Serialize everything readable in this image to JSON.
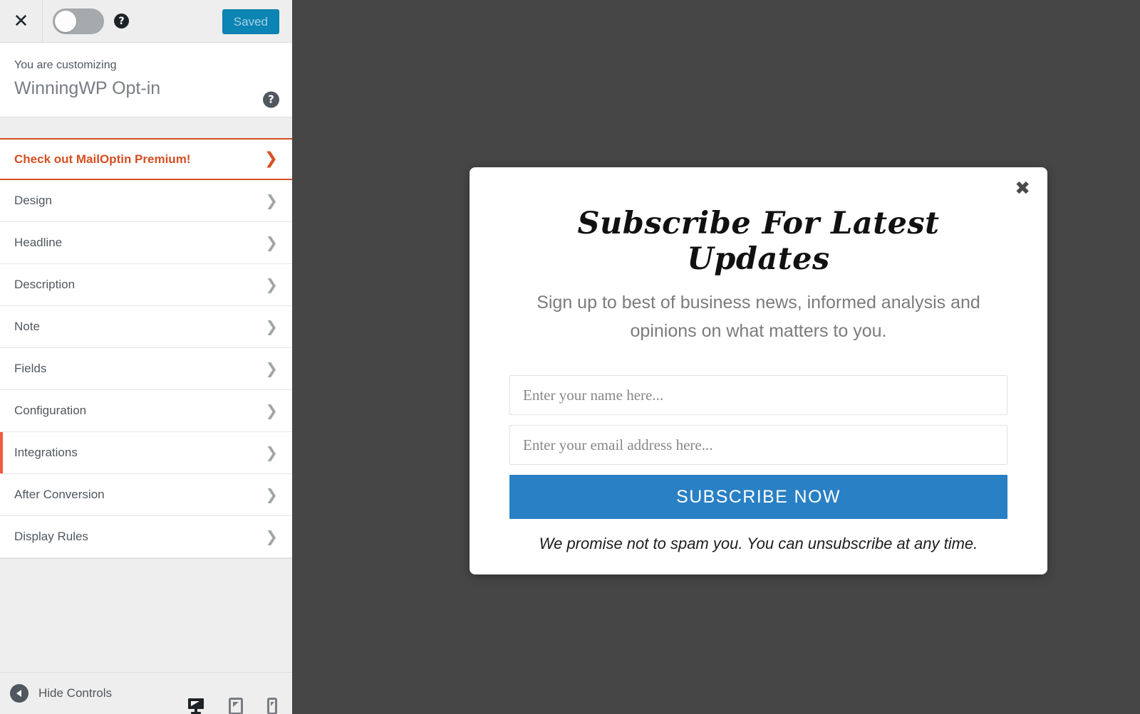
{
  "colors": {
    "accent_orange": "#d54e21",
    "active_marker": "#f15a41",
    "save_button_blue": "#0c84b4",
    "subscribe_blue": "#2980c4",
    "preview_overlay": "#464646",
    "sidebar_bg": "#eeeeee",
    "text_gray": "#50575e"
  },
  "topbar": {
    "close_icon": "close-icon",
    "close_glyph": "✕",
    "toggle": {
      "name": "preview-toggle",
      "state": "off"
    },
    "help_icon_glyph": "?",
    "save_button_label": "Saved"
  },
  "panel_header": {
    "eyebrow": "You are customizing",
    "title": "WinningWP Opt-in",
    "help_icon_glyph": "?"
  },
  "menu": {
    "chevron_glyph": "❯",
    "items": [
      {
        "label": "Check out MailOptin Premium!",
        "style": "premium",
        "active": false
      },
      {
        "label": "Design",
        "style": "normal",
        "active": false
      },
      {
        "label": "Headline",
        "style": "normal",
        "active": false
      },
      {
        "label": "Description",
        "style": "normal",
        "active": false
      },
      {
        "label": "Note",
        "style": "normal",
        "active": false
      },
      {
        "label": "Fields",
        "style": "normal",
        "active": false
      },
      {
        "label": "Configuration",
        "style": "normal",
        "active": false
      },
      {
        "label": "Integrations",
        "style": "normal",
        "active": true
      },
      {
        "label": "After Conversion",
        "style": "normal",
        "active": false
      },
      {
        "label": "Display Rules",
        "style": "normal",
        "active": false
      }
    ]
  },
  "footer": {
    "collapse_label": "Hide Controls",
    "devices": [
      {
        "name": "preview-desktop",
        "icon": "desktop-icon",
        "active": true
      },
      {
        "name": "preview-tablet",
        "icon": "tablet-icon",
        "active": false
      },
      {
        "name": "preview-mobile",
        "icon": "mobile-icon",
        "active": false
      }
    ]
  },
  "optin": {
    "close_glyph": "✖",
    "headline": "Subscribe For Latest Updates",
    "description": "Sign up to best of business news, informed analysis and opinions on what matters to you.",
    "name_placeholder": "Enter your name here...",
    "name_value": "",
    "email_placeholder": "Enter your email address here...",
    "email_value": "",
    "submit_label": "SUBSCRIBE NOW",
    "note": "We promise not to spam you. You can unsubscribe at any time."
  }
}
